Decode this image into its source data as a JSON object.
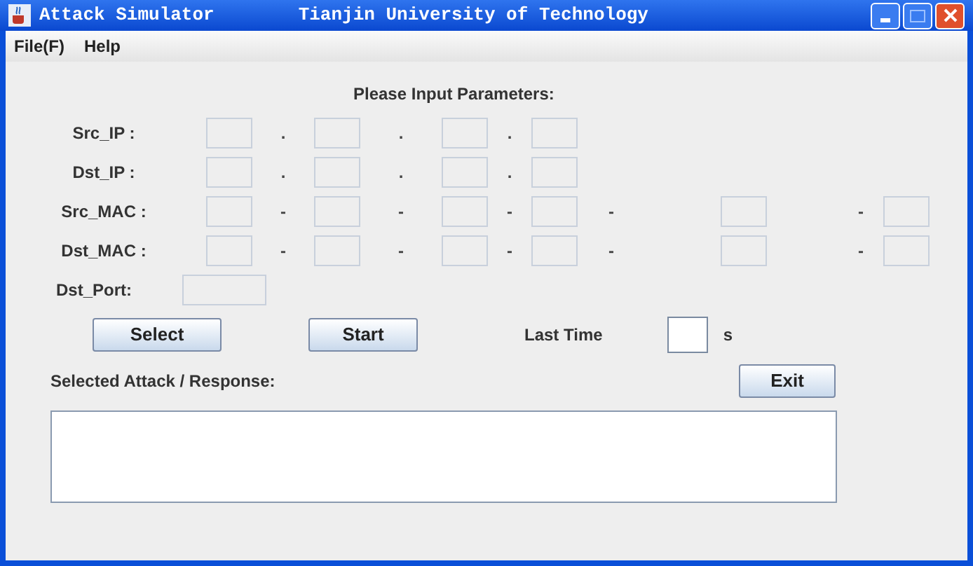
{
  "window": {
    "title": "Attack Simulator",
    "subtitle": "Tianjin University of Technology"
  },
  "menu": [
    "File(F)",
    "Help"
  ],
  "heading": "Please Input Parameters:",
  "rows": [
    {
      "label": "Src_IP :",
      "separators": [
        ".",
        ".",
        "."
      ],
      "fields": [
        {
          "disabled": true
        },
        {
          "disabled": true
        },
        {
          "disabled": true
        },
        {
          "disabled": true
        }
      ]
    },
    {
      "label": "Dst_IP :",
      "separators": [
        ".",
        ".",
        "."
      ],
      "fields": [
        {
          "disabled": true
        },
        {
          "disabled": true
        },
        {
          "disabled": true
        },
        {
          "disabled": true
        }
      ]
    },
    {
      "label": "Src_MAC :",
      "separators": [
        "-",
        "-",
        "-",
        "-",
        "-"
      ],
      "fields": [
        {
          "disabled": true
        },
        {
          "disabled": true
        },
        {
          "disabled": true
        },
        {
          "disabled": true
        },
        {
          "disabled": true
        },
        {
          "disabled": true
        }
      ]
    },
    {
      "label": "Dst_MAC :",
      "separators": [
        "-",
        "-",
        "-",
        "-",
        "-"
      ],
      "fields": [
        {
          "disabled": true
        },
        {
          "disabled": true
        },
        {
          "disabled": true
        },
        {
          "disabled": true
        },
        {
          "disabled": true
        },
        {
          "disabled": true
        }
      ]
    }
  ],
  "port": {
    "label": "Dst_Port:",
    "disabled": true
  },
  "buttons": [
    "Select",
    "Start"
  ],
  "last_time": {
    "label": "Last Time",
    "unit": "s",
    "disabled": false
  },
  "response": {
    "label": "Selected Attack / Response:"
  },
  "exit_button": "Exit"
}
